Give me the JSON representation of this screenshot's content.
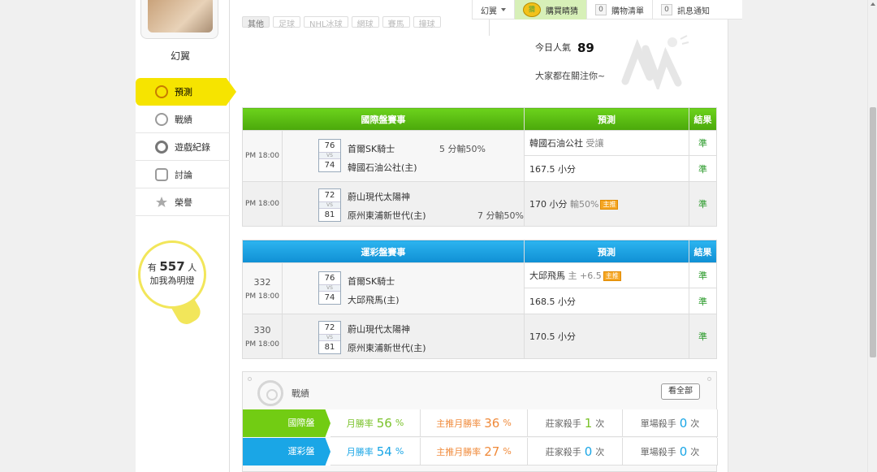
{
  "topnav": {
    "user_menu": "幻翼",
    "buy_label": "購買睛猜",
    "buy_icon_text": "猜",
    "cart_count": "0",
    "cart_label": "購物清單",
    "msg_count": "0",
    "msg_label": "訊息通知"
  },
  "sidebar": {
    "username": "幻翼",
    "items": [
      {
        "label": "預測",
        "icon": "target-icon"
      },
      {
        "label": "戰績",
        "icon": "trophy-icon"
      },
      {
        "label": "遊戲紀錄",
        "icon": "record-icon"
      },
      {
        "label": "討論",
        "icon": "chat-icon"
      },
      {
        "label": "榮譽",
        "icon": "medal-icon"
      }
    ],
    "bulb": {
      "prefix": "有",
      "count": "557",
      "unit": "人",
      "text": "加我為明燈"
    }
  },
  "filters": [
    "其他",
    "足球",
    "NHL冰球",
    "網球",
    "賽馬",
    "撞球"
  ],
  "popularity": {
    "label": "今日人氣",
    "value": "89",
    "subtext": "大家都在關注你~"
  },
  "intl_table": {
    "headers": [
      "國際盤賽事",
      "預測",
      "結果"
    ],
    "rows": [
      {
        "time": "PM 18:00",
        "home_score": "76",
        "vs": "VS",
        "away_score": "74",
        "team1": "首爾SK騎士",
        "team2": "韓國石油公社(主)",
        "odds": "5 分輸50%",
        "pred1_main": "韓國石油公社",
        "pred1_sub": "受讓",
        "result1": "準",
        "pred2_main": "167.5",
        "pred2_sub": "小分",
        "result2": "準"
      },
      {
        "time": "PM 18:00",
        "home_score": "72",
        "vs": "VS",
        "away_score": "81",
        "team1": "蔚山現代太陽神",
        "team2": "原州東浦新世代(主)",
        "odds": "7 分輸50%",
        "pred_main": "170",
        "pred_sub": "小分",
        "pred_extra": "輸50%",
        "pred_tag": "主推",
        "result": "準"
      }
    ]
  },
  "sport_table": {
    "headers": [
      "運彩盤賽事",
      "預測",
      "結果"
    ],
    "rows": [
      {
        "id": "332",
        "time": "PM 18:00",
        "home_score": "76",
        "vs": "VS",
        "away_score": "74",
        "team1": "首爾SK騎士",
        "team2": "大邱飛馬(主)",
        "pred1_main": "大邱飛馬",
        "pred1_sub": "主 +6.5",
        "pred1_tag": "主推",
        "result1": "準",
        "pred2_main": "168.5",
        "pred2_sub": "小分",
        "result2": "準"
      },
      {
        "id": "330",
        "time": "PM 18:00",
        "home_score": "72",
        "vs": "VS",
        "away_score": "81",
        "team1": "蔚山現代太陽神",
        "team2": "原州東浦新世代(主)",
        "pred_main": "170.5",
        "pred_sub": "小分",
        "result": "準"
      }
    ]
  },
  "record": {
    "title": "戰績",
    "view_all": "看全部",
    "rows": [
      {
        "label": "國際盤",
        "win_label": "月勝率",
        "win": "56",
        "pct": "%",
        "main_label": "主推月勝率",
        "main": "36",
        "banker_label": "莊家殺手",
        "banker": "1",
        "single_label": "單場殺手",
        "single": "0",
        "unit": "次"
      },
      {
        "label": "運彩盤",
        "win_label": "月勝率",
        "win": "54",
        "pct": "%",
        "main_label": "主推月勝率",
        "main": "27",
        "banker_label": "莊家殺手",
        "banker": "0",
        "single_label": "單場殺手",
        "single": "0",
        "unit": "次"
      }
    ]
  },
  "colors": {
    "green": "#5bbd14",
    "blue": "#1aa6e6",
    "yellow": "#f6e400",
    "orange": "#f5a623"
  }
}
